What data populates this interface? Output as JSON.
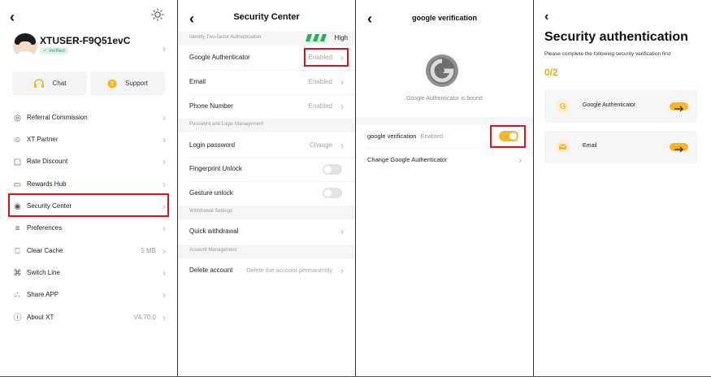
{
  "panel1": {
    "username": "XTUSER-F9Q51evC",
    "verified_label": "Verified",
    "chat_label": "Chat",
    "support_label": "Support",
    "menu": [
      {
        "label": "Referral Commission",
        "value": "",
        "icon": "referral-icon"
      },
      {
        "label": "XT Partner",
        "value": "",
        "icon": "partner-icon"
      },
      {
        "label": "Rate Discount",
        "value": "",
        "icon": "discount-icon"
      },
      {
        "label": "Rewards Hub",
        "value": "",
        "icon": "rewards-icon"
      },
      {
        "label": "Security Center",
        "value": "",
        "icon": "security-icon"
      },
      {
        "label": "Preferences",
        "value": "",
        "icon": "preferences-icon"
      },
      {
        "label": "Clear Cache",
        "value": "5 MB",
        "icon": "trash-icon"
      },
      {
        "label": "Switch Line",
        "value": "",
        "icon": "switch-line-icon"
      },
      {
        "label": "Share APP",
        "value": "",
        "icon": "share-icon"
      },
      {
        "label": "About XT",
        "value": "V4.70.0",
        "icon": "info-icon"
      }
    ]
  },
  "panel2": {
    "title": "Security Center",
    "section_2fa": "Identity Two-factor Authentication",
    "level": "High",
    "google_auth": {
      "label": "Google Authenticator",
      "value": "Enabled"
    },
    "email": {
      "label": "Email",
      "value": "Enabled"
    },
    "phone": {
      "label": "Phone Number",
      "value": "Enabled"
    },
    "section_password": "Password and Login Management",
    "login_password": {
      "label": "Login password",
      "value": "Change"
    },
    "fingerprint": {
      "label": "Fingerprint Unlock"
    },
    "gesture": {
      "label": "Gesture unlock"
    },
    "section_withdrawal": "Withdrawal Settings",
    "quick_withdrawal": {
      "label": "Quick withdrawal"
    },
    "section_account": "Account Management",
    "delete_account": {
      "label": "Delete account",
      "value": "Delete the account permanently"
    }
  },
  "panel3": {
    "title": "google verification",
    "bound_text": "Google Authenticator is bound",
    "verification_label": "google verification",
    "verification_status": "Enabled",
    "change_label": "Change Google Authenticator"
  },
  "panel4": {
    "title": "Security authentication",
    "subtitle": "Please complete the following security verification first",
    "progress": "0/2",
    "items": [
      {
        "label": "Google Authenticator",
        "icon": "google-g-icon"
      },
      {
        "label": "Email",
        "icon": "envelope-icon"
      }
    ]
  },
  "colors": {
    "accent": "#f4b52d",
    "highlight_box": "#e0101a",
    "verified_green": "#2ea35a"
  }
}
